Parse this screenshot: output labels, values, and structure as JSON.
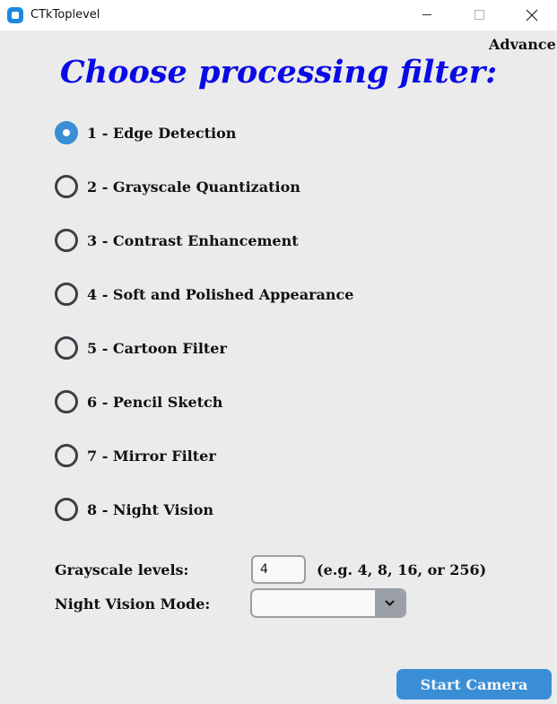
{
  "window": {
    "title": "CTkToplevel"
  },
  "menu": {
    "advance_label": "Advance"
  },
  "heading": "Choose processing filter:",
  "filters": [
    {
      "label": "1 - Edge Detection",
      "selected": true
    },
    {
      "label": "2 - Grayscale Quantization",
      "selected": false
    },
    {
      "label": "3 - Contrast Enhancement",
      "selected": false
    },
    {
      "label": "4 - Soft and Polished Appearance",
      "selected": false
    },
    {
      "label": "5 - Cartoon Filter",
      "selected": false
    },
    {
      "label": "6 - Pencil Sketch",
      "selected": false
    },
    {
      "label": "7 - Mirror Filter",
      "selected": false
    },
    {
      "label": "8 - Night Vision",
      "selected": false
    }
  ],
  "grayscale": {
    "label": "Grayscale levels:",
    "value": "4",
    "hint": "(e.g. 4, 8, 16, or 256)"
  },
  "night_vision": {
    "label": "Night Vision Mode:",
    "value": ""
  },
  "start_button": {
    "label": "Start Camera"
  },
  "colors": {
    "accent": "#3a8ed6",
    "heading": "#0a0ae6",
    "background": "#ebebeb"
  }
}
